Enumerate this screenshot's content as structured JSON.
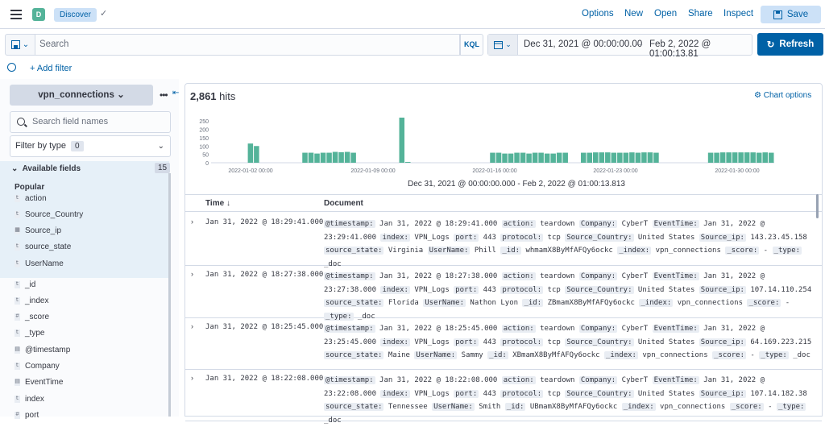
{
  "topbar": {
    "space_letter": "D",
    "breadcrumb": "Discover",
    "links": [
      "Options",
      "New",
      "Open",
      "Share",
      "Inspect"
    ],
    "save_label": "Save"
  },
  "query": {
    "placeholder": "Search",
    "language": "KQL",
    "date_start": "Dec 31, 2021 @ 00:00:00.00",
    "date_arrow": "→",
    "date_end": "Feb 2, 2022 @ 01:00:13.81",
    "refresh_label": "Refresh",
    "add_filter": "+ Add filter"
  },
  "sidebar": {
    "index_pattern": "vpn_connections",
    "search_placeholder": "Search field names",
    "filter_by_type": "Filter by type",
    "filter_count": "0",
    "available_fields": "Available fields",
    "available_count": "15",
    "popular_label": "Popular",
    "popular_fields": [
      {
        "type": "t",
        "name": "action"
      },
      {
        "type": "t",
        "name": "Source_Country"
      },
      {
        "type": "ip",
        "name": "Source_ip"
      },
      {
        "type": "t",
        "name": "source_state"
      },
      {
        "type": "t",
        "name": "UserName"
      }
    ],
    "other_fields": [
      {
        "type": "t",
        "name": "_id"
      },
      {
        "type": "t",
        "name": "_index"
      },
      {
        "type": "#",
        "name": "_score"
      },
      {
        "type": "t",
        "name": "_type"
      },
      {
        "type": "date",
        "name": "@timestamp"
      },
      {
        "type": "t",
        "name": "Company"
      },
      {
        "type": "date",
        "name": "EventTime"
      },
      {
        "type": "t",
        "name": "index"
      },
      {
        "type": "#",
        "name": "port"
      }
    ]
  },
  "results": {
    "hits_count": "2,861",
    "hits_label": "hits",
    "chart_options": "Chart options",
    "date_range_label": "Dec 31, 2021 @ 00:00:00.000 - Feb 2, 2022 @ 01:00:13.813",
    "col_time": "Time ↓",
    "col_document": "Document",
    "rows": [
      {
        "time": "Jan 31, 2022 @ 18:29:41.000",
        "fields": [
          [
            "@timestamp:",
            "Jan 31, 2022 @ 18:29:41.000"
          ],
          [
            "action:",
            "teardown"
          ],
          [
            "Company:",
            "CyberT"
          ],
          [
            "EventTime:",
            "Jan 31, 2022 @ 23:29:41.000"
          ],
          [
            "index:",
            "VPN_Logs"
          ],
          [
            "port:",
            "443"
          ],
          [
            "protocol:",
            "tcp"
          ],
          [
            "Source_Country:",
            "United States"
          ],
          [
            "Source_ip:",
            "143.23.45.158"
          ],
          [
            "source_state:",
            "Virginia"
          ],
          [
            "UserName:",
            "Phill"
          ],
          [
            "_id:",
            "whmamX8ByMfAFQy6ockc"
          ],
          [
            "_index:",
            "vpn_connections"
          ],
          [
            "_score:",
            "-"
          ],
          [
            "_type:",
            "_doc"
          ]
        ]
      },
      {
        "time": "Jan 31, 2022 @ 18:27:38.000",
        "fields": [
          [
            "@timestamp:",
            "Jan 31, 2022 @ 18:27:38.000"
          ],
          [
            "action:",
            "teardown"
          ],
          [
            "Company:",
            "CyberT"
          ],
          [
            "EventTime:",
            "Jan 31, 2022 @ 23:27:38.000"
          ],
          [
            "index:",
            "VPN_Logs"
          ],
          [
            "port:",
            "443"
          ],
          [
            "protocol:",
            "tcp"
          ],
          [
            "Source_Country:",
            "United States"
          ],
          [
            "Source_ip:",
            "107.14.110.254"
          ],
          [
            "source_state:",
            "Florida"
          ],
          [
            "UserName:",
            "Nathon Lyon"
          ],
          [
            "_id:",
            "ZBmamX8ByMfAFQy6ockc"
          ],
          [
            "_index:",
            "vpn_connections"
          ],
          [
            "_score:",
            "-"
          ],
          [
            "_type:",
            "_doc"
          ]
        ]
      },
      {
        "time": "Jan 31, 2022 @ 18:25:45.000",
        "fields": [
          [
            "@timestamp:",
            "Jan 31, 2022 @ 18:25:45.000"
          ],
          [
            "action:",
            "teardown"
          ],
          [
            "Company:",
            "CyberT"
          ],
          [
            "EventTime:",
            "Jan 31, 2022 @ 23:25:45.000"
          ],
          [
            "index:",
            "VPN_Logs"
          ],
          [
            "port:",
            "443"
          ],
          [
            "protocol:",
            "tcp"
          ],
          [
            "Source_Country:",
            "United States"
          ],
          [
            "Source_ip:",
            "64.169.223.215"
          ],
          [
            "source_state:",
            "Maine"
          ],
          [
            "UserName:",
            "Sammy"
          ],
          [
            "_id:",
            "XBmamX8ByMfAFQy6ockc"
          ],
          [
            "_index:",
            "vpn_connections"
          ],
          [
            "_score:",
            "-"
          ],
          [
            "_type:",
            "_doc"
          ]
        ]
      },
      {
        "time": "Jan 31, 2022 @ 18:22:08.000",
        "fields": [
          [
            "@timestamp:",
            "Jan 31, 2022 @ 18:22:08.000"
          ],
          [
            "action:",
            "teardown"
          ],
          [
            "Company:",
            "CyberT"
          ],
          [
            "EventTime:",
            "Jan 31, 2022 @ 23:22:08.000"
          ],
          [
            "index:",
            "VPN_Logs"
          ],
          [
            "port:",
            "443"
          ],
          [
            "protocol:",
            "tcp"
          ],
          [
            "Source_Country:",
            "United States"
          ],
          [
            "Source_ip:",
            "107.14.182.38"
          ],
          [
            "source_state:",
            "Tennessee"
          ],
          [
            "UserName:",
            "Smith"
          ],
          [
            "_id:",
            "UBmamX8ByMfAFQy6ockc"
          ],
          [
            "_index:",
            "vpn_connections"
          ],
          [
            "_score:",
            "-"
          ],
          [
            "_type:",
            "_doc"
          ]
        ]
      }
    ]
  },
  "colors": {
    "primary": "#0061a6",
    "bar": "#54b399",
    "highlight": "#e6f0f8"
  },
  "chart_data": {
    "type": "bar",
    "ylim": [
      0,
      270
    ],
    "y_ticks": [
      "250",
      "200",
      "150",
      "100",
      "50",
      "0"
    ],
    "x_ticks": [
      "2022-01-02 00:00",
      "2022-01-09 00:00",
      "2022-01-16 00:00",
      "2022-01-23 00:00",
      "2022-01-30 00:00"
    ],
    "values": [
      0,
      0,
      0,
      0,
      0,
      0,
      115,
      100,
      0,
      0,
      0,
      0,
      0,
      0,
      0,
      60,
      60,
      55,
      60,
      60,
      65,
      63,
      65,
      60,
      0,
      0,
      0,
      0,
      0,
      0,
      0,
      270,
      5,
      0,
      0,
      0,
      0,
      0,
      0,
      0,
      0,
      0,
      0,
      0,
      0,
      0,
      60,
      60,
      55,
      55,
      60,
      60,
      55,
      60,
      60,
      55,
      55,
      60,
      60,
      0,
      0,
      60,
      60,
      62,
      62,
      62,
      60,
      60,
      60,
      62,
      60,
      62,
      62,
      60,
      0,
      0,
      0,
      0,
      0,
      0,
      0,
      0,
      60,
      60,
      62,
      62,
      62,
      62,
      62,
      62,
      60,
      62,
      60
    ]
  }
}
